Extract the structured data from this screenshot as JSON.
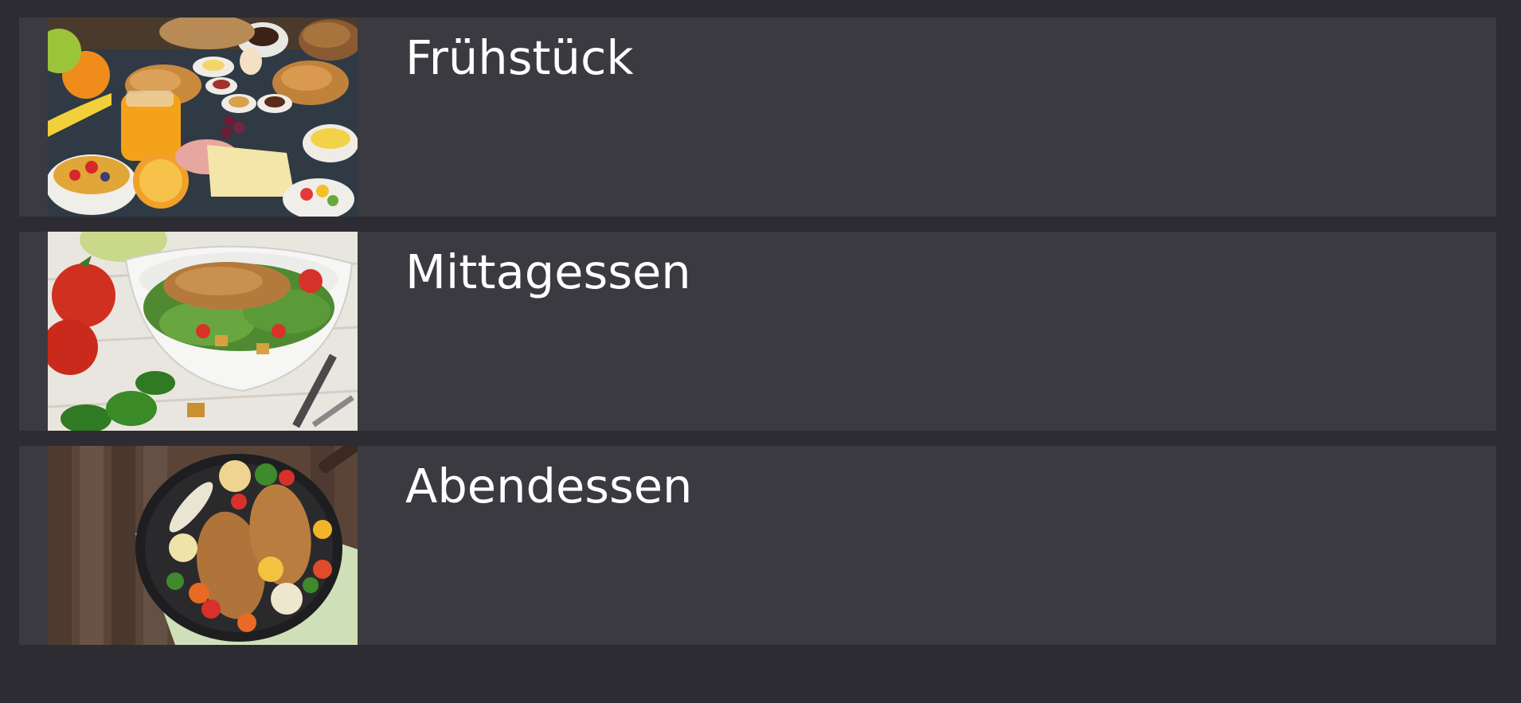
{
  "meals": [
    {
      "title": "Frühstück",
      "image": "breakfast-table-photo"
    },
    {
      "title": "Mittagessen",
      "image": "chicken-salad-bowl-photo"
    },
    {
      "title": "Abendessen",
      "image": "chicken-vegetable-pan-photo"
    }
  ]
}
